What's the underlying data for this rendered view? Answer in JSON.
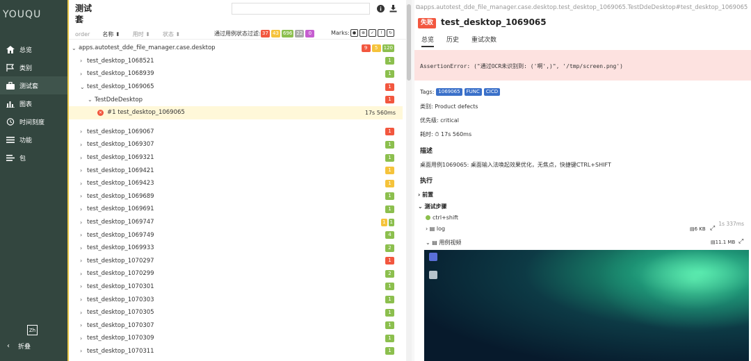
{
  "sidebar": {
    "logo": "YOUQU",
    "items": [
      {
        "label": "总览",
        "icon": "home-icon"
      },
      {
        "label": "类别",
        "icon": "flag-icon"
      },
      {
        "label": "测试套",
        "icon": "briefcase-icon"
      },
      {
        "label": "图表",
        "icon": "bar-chart-icon"
      },
      {
        "label": "时间刻度",
        "icon": "clock-icon"
      },
      {
        "label": "功能",
        "icon": "list-icon"
      },
      {
        "label": "包",
        "icon": "package-icon"
      }
    ],
    "lang_label": "Zh",
    "collapse_label": "折叠"
  },
  "tree_panel": {
    "title": "测试套",
    "search_placeholder": "",
    "sort_columns": [
      "order",
      "名称",
      "用时",
      "状态"
    ],
    "filter_label": "通过用例状态过滤:",
    "filter_counts": {
      "failed": "37",
      "broken": "43",
      "passed": "696",
      "skipped": "22",
      "unknown": "0"
    },
    "marks_label": "Marks:",
    "root": {
      "label": "apps.autotest_dde_file_manager.case.desktop",
      "counts": {
        "failed": "9",
        "broken": "5",
        "passed": "120"
      }
    },
    "rows": [
      {
        "label": "test_desktop_1068521",
        "status": "passed",
        "count": "1"
      },
      {
        "label": "test_desktop_1068939",
        "status": "passed",
        "count": "1"
      },
      {
        "label": "test_desktop_1069065",
        "status": "failed",
        "count": "1",
        "expanded": true
      },
      {
        "label": "TestDdeDesktop",
        "status": "failed",
        "count": "1",
        "level": 2,
        "expanded": true
      },
      {
        "label": "#1  test_desktop_1069065",
        "status": "failed",
        "duration": "17s 560ms",
        "level": 3,
        "selected": true
      },
      {
        "label": "test_desktop_1069067",
        "status": "failed",
        "count": "1"
      },
      {
        "label": "test_desktop_1069307",
        "status": "passed",
        "count": "1"
      },
      {
        "label": "test_desktop_1069321",
        "status": "passed",
        "count": "1"
      },
      {
        "label": "test_desktop_1069421",
        "status": "broken",
        "count": "1"
      },
      {
        "label": "test_desktop_1069423",
        "status": "broken",
        "count": "1"
      },
      {
        "label": "test_desktop_1069689",
        "status": "passed",
        "count": "1"
      },
      {
        "label": "test_desktop_1069691",
        "status": "passed",
        "count": "1"
      },
      {
        "label": "test_desktop_1069747",
        "status": "mixed",
        "counts": {
          "broken": "1",
          "passed": "1"
        }
      },
      {
        "label": "test_desktop_1069749",
        "status": "passed",
        "count": "4"
      },
      {
        "label": "test_desktop_1069933",
        "status": "passed",
        "count": "2"
      },
      {
        "label": "test_desktop_1070297",
        "status": "failed",
        "count": "1"
      },
      {
        "label": "test_desktop_1070299",
        "status": "passed",
        "count": "2"
      },
      {
        "label": "test_desktop_1070301",
        "status": "passed",
        "count": "1"
      },
      {
        "label": "test_desktop_1070303",
        "status": "passed",
        "count": "1"
      },
      {
        "label": "test_desktop_1070305",
        "status": "passed",
        "count": "1"
      },
      {
        "label": "test_desktop_1070307",
        "status": "passed",
        "count": "1"
      },
      {
        "label": "test_desktop_1070309",
        "status": "passed",
        "count": "1"
      },
      {
        "label": "test_desktop_1070311",
        "status": "passed",
        "count": "1"
      }
    ]
  },
  "detail": {
    "breadcrumb": "apps.autotest_dde_file_manager.case.desktop.test_desktop_1069065.TestDdeDesktop#test_desktop_1069065",
    "status_label": "失败",
    "title": "test_desktop_1069065",
    "tabs": [
      "总览",
      "历史",
      "重试次数"
    ],
    "error": "AssertionError: (\"通过OCR未识别到: ('啊',)\", '/tmp/screen.png')",
    "tags_label": "Tags:",
    "tags": [
      "1069065",
      "FUNC",
      "CICD"
    ],
    "category": "类别: Product defects",
    "severity": "优先级: critical",
    "duration": "耗时: ⏱ 17s 560ms",
    "desc_heading": "描述",
    "description": "桌面用例1069065: 桌面输入法唤起效果优化，无焦点，快捷键CTRL+SHIFT",
    "exec_heading": "执行",
    "setup_label": "前置",
    "steps_label": "测试步骤",
    "step_name": "ctrl+shift",
    "step_time": "1s 337ms",
    "attach_log": "log",
    "attach_log_size": "6 KB",
    "attach_video": "用例视频",
    "attach_video_size": "11.1 MB"
  },
  "colors": {
    "failed": "#f2573f",
    "broken": "#f5c33b",
    "passed": "#8cbf4e",
    "skipped": "#aaaaaa",
    "unknown": "#c65dd0",
    "sidebar": "#33463f",
    "tag": "#3a70c9"
  }
}
